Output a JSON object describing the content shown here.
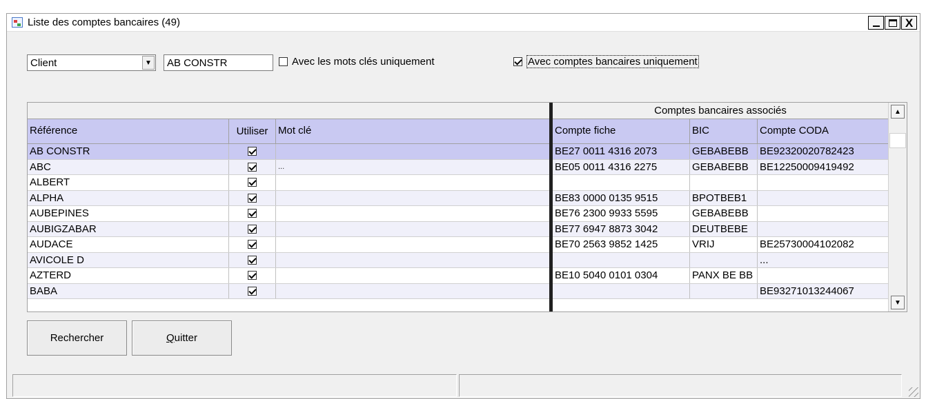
{
  "window": {
    "title": "Liste des comptes bancaires (49)",
    "controls": {
      "minimize": "_",
      "maximize": "□",
      "close": "X"
    }
  },
  "filters": {
    "type_select": {
      "value": "Client"
    },
    "search_value": "AB CONSTR",
    "keywords_only": {
      "label": "Avec les mots clés uniquement",
      "checked": false
    },
    "bank_accounts_only": {
      "label": "Avec comptes bancaires uniquement",
      "checked": true
    }
  },
  "grid": {
    "group_header": "Comptes bancaires associés",
    "columns": {
      "reference": "Référence",
      "use": "Utiliser",
      "keyword": "Mot clé",
      "account": "Compte fiche",
      "bic": "BIC",
      "coda": "Compte CODA"
    },
    "rows": [
      {
        "reference": "AB CONSTR",
        "use": true,
        "keyword": "",
        "account": "BE27 0011 4316 2073",
        "bic": "GEBABEBB",
        "coda": "BE92320020782423"
      },
      {
        "reference": "ABC",
        "use": true,
        "keyword": "...",
        "account": "BE05 0011 4316 2275",
        "bic": "GEBABEBB",
        "coda": "BE12250009419492"
      },
      {
        "reference": "ALBERT",
        "use": true,
        "keyword": "",
        "account": "",
        "bic": "",
        "coda": ""
      },
      {
        "reference": "ALPHA",
        "use": true,
        "keyword": "",
        "account": "BE83 0000 0135 9515",
        "bic": "BPOTBEB1",
        "coda": ""
      },
      {
        "reference": "AUBEPINES",
        "use": true,
        "keyword": "",
        "account": "BE76 2300 9933 5595",
        "bic": "GEBABEBB",
        "coda": ""
      },
      {
        "reference": "AUBIGZABAR",
        "use": true,
        "keyword": "",
        "account": "BE77 6947 8873 3042",
        "bic": "DEUTBEBE",
        "coda": ""
      },
      {
        "reference": "AUDACE",
        "use": true,
        "keyword": "",
        "account": "BE70 2563 9852 1425",
        "bic": "VRIJ",
        "coda": "BE25730004102082"
      },
      {
        "reference": "AVICOLE D",
        "use": true,
        "keyword": "",
        "account": "",
        "bic": "",
        "coda": "..."
      },
      {
        "reference": "AZTERD",
        "use": true,
        "keyword": "",
        "account": "BE10 5040 0101 0304",
        "bic": "PANX BE BB",
        "coda": ""
      },
      {
        "reference": "BABA",
        "use": true,
        "keyword": "",
        "account": "",
        "bic": "",
        "coda": "BE93271013244067"
      }
    ],
    "selected_row": 0
  },
  "buttons": {
    "search": "Rechercher",
    "quit": "Quitter"
  },
  "icons": {
    "app": "bank-list-app-icon",
    "dropdown": "chevron-down-icon",
    "scroll_up": "arrow-up-icon",
    "scroll_down": "arrow-down-icon"
  }
}
